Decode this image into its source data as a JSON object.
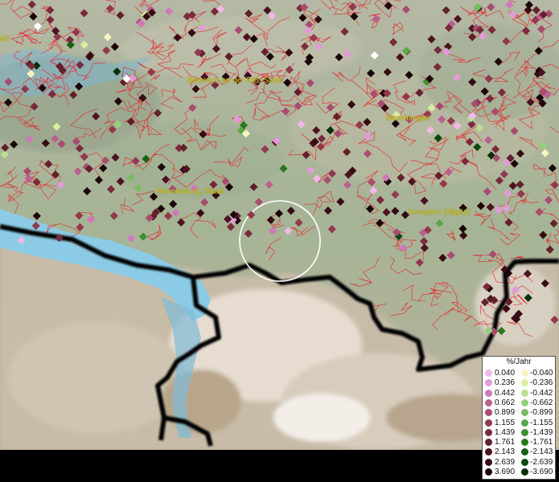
{
  "cities": [
    {
      "name": "Biberach an der Riß, Stadt",
      "label": "Biberach an der Riß, Stadt"
    },
    {
      "name": "Memmingen",
      "label": "Memmingen"
    },
    {
      "name": "Ravensburg, Stadt",
      "label": "Ravensburg, Stadt"
    },
    {
      "name": "Kempten (Allgäu)",
      "label": "Kempten (Allgäu)"
    },
    {
      "name": "edge",
      "label": "adt"
    }
  ],
  "legend": {
    "title": "%/Jahr",
    "positive": [
      "0.040",
      "0.236",
      "0.442",
      "0.662",
      "0.899",
      "1.155",
      "1.439",
      "1.761",
      "2.143",
      "2.639",
      "3.690"
    ],
    "negative": [
      "-0.040",
      "-0.236",
      "-0.442",
      "-0.662",
      "-0.899",
      "-1.155",
      "-1.439",
      "-1.761",
      "-2.143",
      "-2.639",
      "-3.690"
    ],
    "positive_colors": [
      "#f2b8e8",
      "#e49ad8",
      "#cf7ab8",
      "#bb6090",
      "#a84c70",
      "#92384f",
      "#7a2a3c",
      "#62202c",
      "#4b1420",
      "#360c14",
      "#1a0508"
    ],
    "negative_colors": [
      "#f6f4c0",
      "#d8eea0",
      "#b8e090",
      "#98d078",
      "#78bc60",
      "#58a848",
      "#3c9030",
      "#287820",
      "#186014",
      "#0c480c",
      "#063006"
    ]
  },
  "colors": {
    "lake": "#8ccbe6",
    "terrain": "#a9b79a",
    "border": "#000000",
    "region_lines": "#e8232a",
    "focus_circle": "#ffffff"
  }
}
